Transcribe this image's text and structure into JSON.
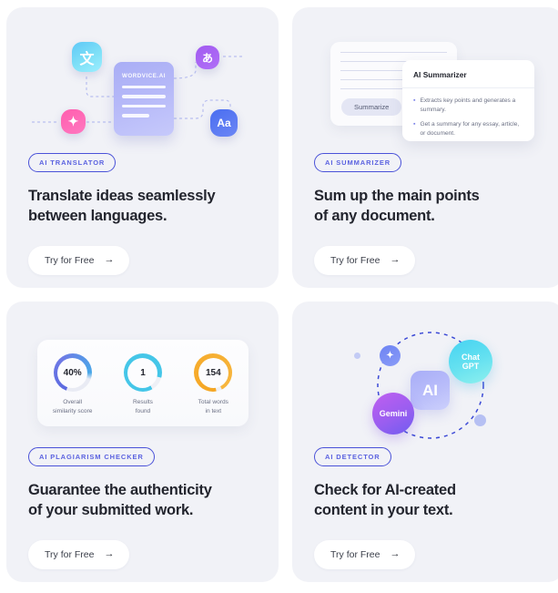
{
  "colors": {
    "card_bg": "#f1f2f7",
    "badge_border": "#4a52d8",
    "badge_text": "#5b62e0",
    "headline": "#23252e",
    "cta_bg": "#ffffff",
    "ring_similarity": "#5b6ae0",
    "ring_results": "#45c6e8",
    "ring_words": "#f5a623"
  },
  "cards": [
    {
      "badge": "AI TRANSLATOR",
      "headline": "Translate ideas seamlessly\nbetween languages.",
      "cta": "Try for Free",
      "cta_icon": "arrow-right-icon",
      "illustration": {
        "doc_title": "WORDVICE.AI",
        "tiles": [
          {
            "name": "chinese-character-icon",
            "glyph": "文"
          },
          {
            "name": "japanese-character-icon",
            "glyph": "あ"
          },
          {
            "name": "sparkle-icon",
            "glyph": "✦"
          },
          {
            "name": "latin-letters-icon",
            "glyph": "Aa"
          }
        ]
      }
    },
    {
      "badge": "AI SUMMARIZER",
      "headline": "Sum up the main points\nof any document.",
      "cta": "Try for Free",
      "cta_icon": "arrow-right-icon",
      "illustration": {
        "summarize_button": "Summarize",
        "panel_title": "AI Summarizer",
        "bullets": [
          "Extracts key points and generates a summary.",
          "Get a summary for any essay, article, or document."
        ]
      }
    },
    {
      "badge": "AI PLAGIARISM CHECKER",
      "headline": "Guarantee the authenticity\nof your submitted work.",
      "cta": "Try for Free",
      "cta_icon": "arrow-right-icon",
      "illustration": {
        "stats": [
          {
            "value": "40%",
            "caption": "Overall\nsimilarity score"
          },
          {
            "value": "1",
            "caption": "Results\nfound"
          },
          {
            "value": "154",
            "caption": "Total words\nin text"
          }
        ]
      }
    },
    {
      "badge": "AI DETECTOR",
      "headline": "Check for AI-created\ncontent in your text.",
      "cta": "Try for Free",
      "cta_icon": "arrow-right-icon",
      "illustration": {
        "center_label": "AI",
        "bubbles": [
          {
            "name": "chatgpt-bubble",
            "label": "Chat\nGPT"
          },
          {
            "name": "gemini-bubble",
            "label": "Gemini"
          },
          {
            "name": "sparkle-bubble",
            "label": "✦"
          }
        ]
      }
    }
  ],
  "chart_data": {
    "type": "pie",
    "title": "Plagiarism check results",
    "series": [
      {
        "name": "Overall similarity score",
        "value": 40,
        "unit": "%",
        "max": 100,
        "color": "#5b6ae0",
        "filled_fraction": 0.75
      },
      {
        "name": "Results found",
        "value": 1,
        "unit": "",
        "color": "#45c6e8",
        "filled_fraction": 0.88
      },
      {
        "name": "Total words in text",
        "value": 154,
        "unit": "",
        "color": "#f5a623",
        "filled_fraction": 0.95
      }
    ]
  }
}
